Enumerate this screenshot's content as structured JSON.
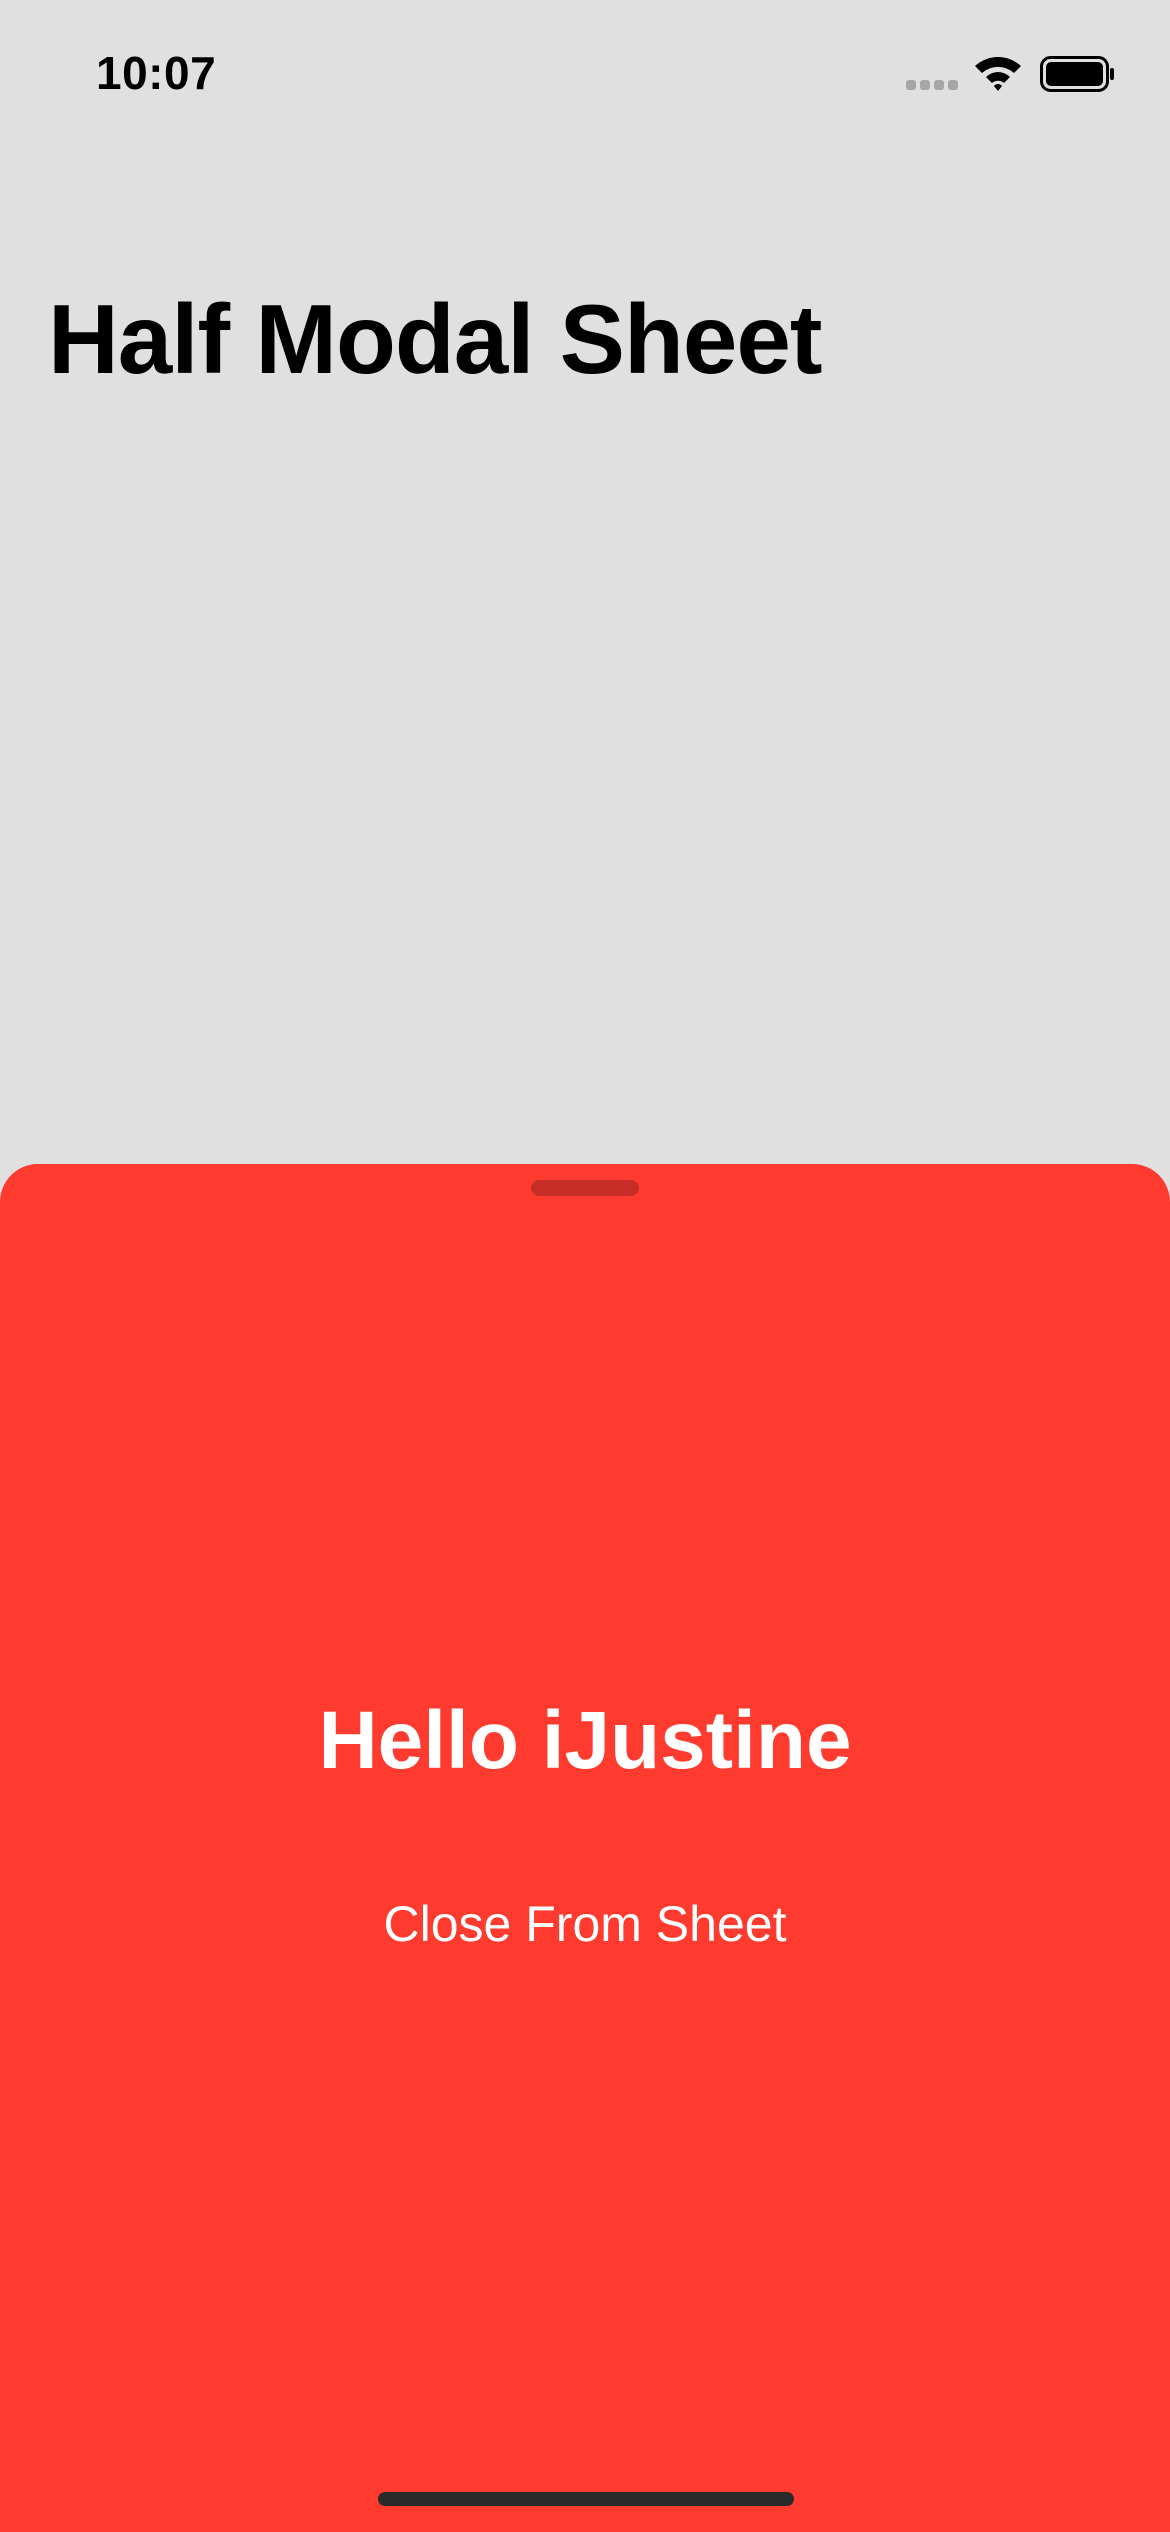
{
  "status_bar": {
    "time": "10:07"
  },
  "screen": {
    "title": "Half Modal Sheet"
  },
  "sheet": {
    "heading": "Hello iJustine",
    "close_button_label": "Close From Sheet",
    "background_color": "#ff3b30"
  },
  "icons": {
    "signal": "signal-icon",
    "wifi": "wifi-icon",
    "battery": "battery-icon",
    "grabber": "sheet-grabber",
    "home": "home-indicator"
  }
}
